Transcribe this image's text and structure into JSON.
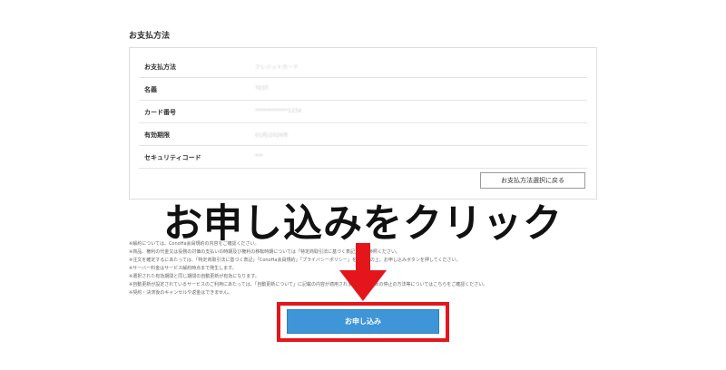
{
  "section": {
    "title": "お支払方法"
  },
  "payment_rows": [
    {
      "label": "お支払方法",
      "value": "クレジットカード"
    },
    {
      "label": "名義",
      "value": "TEST"
    },
    {
      "label": "カード番号",
      "value": "************1234"
    },
    {
      "label": "有効期限",
      "value": "01月/2026年"
    },
    {
      "label": "セキュリティコード",
      "value": "***"
    }
  ],
  "back_button": {
    "label": "お支払方法選択に戻る"
  },
  "headline": {
    "text": "お申し込みをクリック"
  },
  "notes": [
    "※解約については、ConoHa会員規約の内容をご確認ください。",
    "※商品、権利の代金又は役務の対価の支払いの時期及び権利の移転時期については「特定商取引法に基づく表記」をご参照ください。",
    "※注文を確定するにあたっては、「特定商取引法に基づく表記」「ConoHa会員規約」「プライバシーポリシー」をご確認の上、お申し込みボタンを押してください。",
    "※サーバー料金はサービス解約時点まで発生します。",
    "※選択された有効期間と同じ期間の自動更新が有効になります。",
    "※自動更新が設定されているサービスのご利用にあたっては、「自動更新について」に記載の内容が適用されます。自動更新の停止の方法等についてはこちらをご確認ください。",
    "※契約・決済後のキャンセルや返金はできません。"
  ],
  "cta": {
    "label": "お申し込み"
  },
  "colors": {
    "cta_blue": "#3e95d8",
    "highlight_red": "#e4161b"
  }
}
